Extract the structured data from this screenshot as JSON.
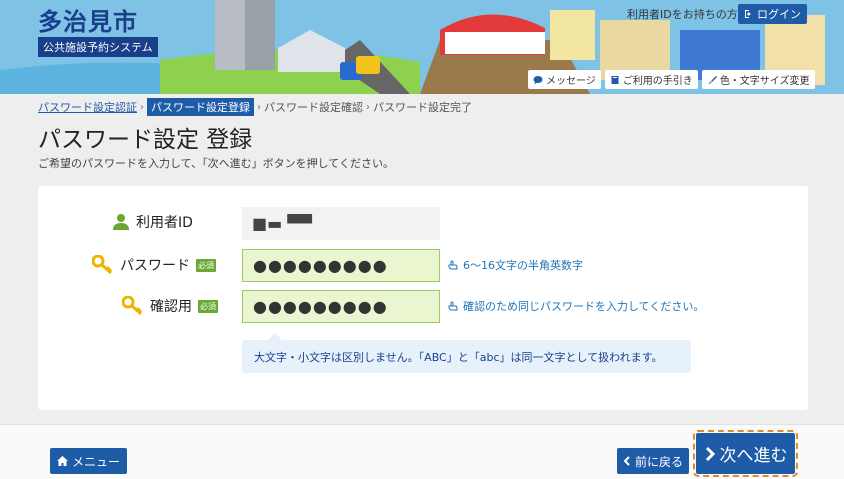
{
  "header": {
    "city_name": "多治見市",
    "system_name": "公共施設予約システム",
    "login_hint": "利用者IDをお持ちの方",
    "login_label": "ログイン",
    "links": [
      {
        "label": "メッセージ",
        "icon": "speech-bubble-icon"
      },
      {
        "label": "ご利用の手引き",
        "icon": "book-icon"
      },
      {
        "label": "色・文字サイズ変更",
        "icon": "brush-icon"
      }
    ]
  },
  "breadcrumb": [
    {
      "label": "パスワード設定認証",
      "state": "link"
    },
    {
      "label": "パスワード設定登録",
      "state": "active"
    },
    {
      "label": "パスワード設定確認",
      "state": "plain"
    },
    {
      "label": "パスワード設定完了",
      "state": "plain"
    }
  ],
  "page": {
    "title": "パスワード設定 登録",
    "description": "ご希望のパスワードを入力して、「次へ進む」ボタンを押してください。"
  },
  "form": {
    "user_id_label": "利用者ID",
    "user_id_value": "■▬ ▀▀",
    "password_label": "パスワード",
    "confirm_label": "確認用",
    "required_badge": "必須",
    "password_value": "●●●●●●●●●",
    "confirm_value": "●●●●●●●●●",
    "password_hint": "6～16文字の半角英数字",
    "confirm_hint": "確認のため同じパスワードを入力してください。",
    "note": "大文字・小文字は区別しません。「ABC」と「abc」は同一文字として扱われます。"
  },
  "footer": {
    "menu_label": "メニュー",
    "back_label": "前に戻る",
    "next_label": "次へ進む"
  },
  "colors": {
    "brand": "#1f5ca8",
    "required": "#6aa832",
    "key_icon": "#f0b400",
    "user_icon": "#6aa832"
  }
}
